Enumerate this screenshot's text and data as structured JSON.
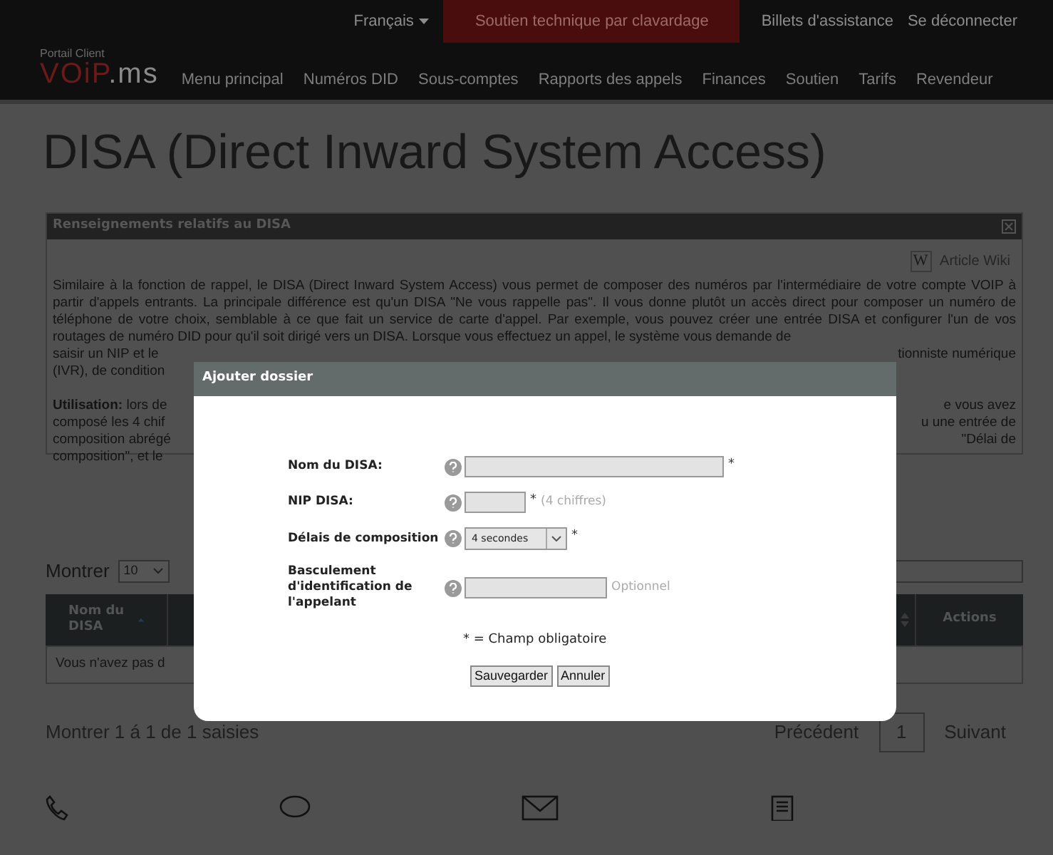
{
  "header": {
    "language": "Français",
    "chat_button": "Soutien technique par clavardage",
    "links": [
      "Billets d'assistance",
      "Se déconnecter"
    ],
    "portal_label": "Portail Client",
    "logo": [
      "VOiP",
      ".ms"
    ],
    "nav": [
      "Menu principal",
      "Numéros DID",
      "Sous-comptes",
      "Rapports des appels",
      "Finances",
      "Soutien",
      "Tarifs",
      "Revendeur"
    ]
  },
  "page_title": "DISA (Direct Inward System Access)",
  "info_panel": {
    "title": "Renseignements relatifs au DISA",
    "wiki_badge": "W",
    "wiki_link": "Article Wiki",
    "intro": "Similaire à la fonction de rappel, le DISA (Direct Inward System Access) vous permet de composer des numéros par l'intermédiaire de votre compte VOIP à partir d'appels entrants. La principale différence est qu'un DISA \"Ne vous rappelle pas\". Il vous donne plutôt un accès direct pour composer un numéro de téléphone de votre choix, semblable à ce que fait un service de carte d'appel. Par exemple, vous pouvez créer une entrée DISA et configurer l'un de vos routages de numéro DID pour qu'il soit dirigé vers un DISA. Lorsque vous effectuez un appel, le système vous demande de",
    "intro_fragments": [
      {
        "left": "saisir un NIP et le",
        "right": "tionniste numérique"
      },
      {
        "left": "(IVR), de condition"
      }
    ],
    "usage_fragments": [
      {
        "left": "**Utilisation:** lors de",
        "right": "e vous avez"
      },
      {
        "left": "composé les 4 chif",
        "right": "u une entrée de"
      },
      {
        "left": "composition abrégé",
        "right": "\"Délai de"
      },
      {
        "left": "composition\", et le"
      }
    ]
  },
  "table": {
    "show_label": "Montrer",
    "page_size": "10",
    "first_column": "Nom du DISA",
    "last_column": "Actions",
    "empty_fragment": "Vous n'avez pas d",
    "pagination": {
      "summary": "Montrer 1 á 1 de 1 saisies",
      "previous": "Précédent",
      "page": "1",
      "next": "Suivant"
    }
  },
  "dialog": {
    "title": "Ajouter dossier",
    "required_mark": "*",
    "fields": [
      {
        "kind": "wide",
        "label": "Nom du DISA:",
        "required": true
      },
      {
        "kind": "pin",
        "label": "NIP DISA:",
        "required": true,
        "hint": "(4 chiffres)"
      },
      {
        "kind": "select",
        "label": "Délais de composition",
        "value": "4 secondes",
        "required": true
      },
      {
        "kind": "text",
        "label": "Basculement d'identification de l'appelant",
        "required": false,
        "hint": "Optionnel"
      }
    ],
    "required_note": "* = Champ obligatoire",
    "buttons": [
      "Sauvegarder",
      "Annuler"
    ]
  }
}
